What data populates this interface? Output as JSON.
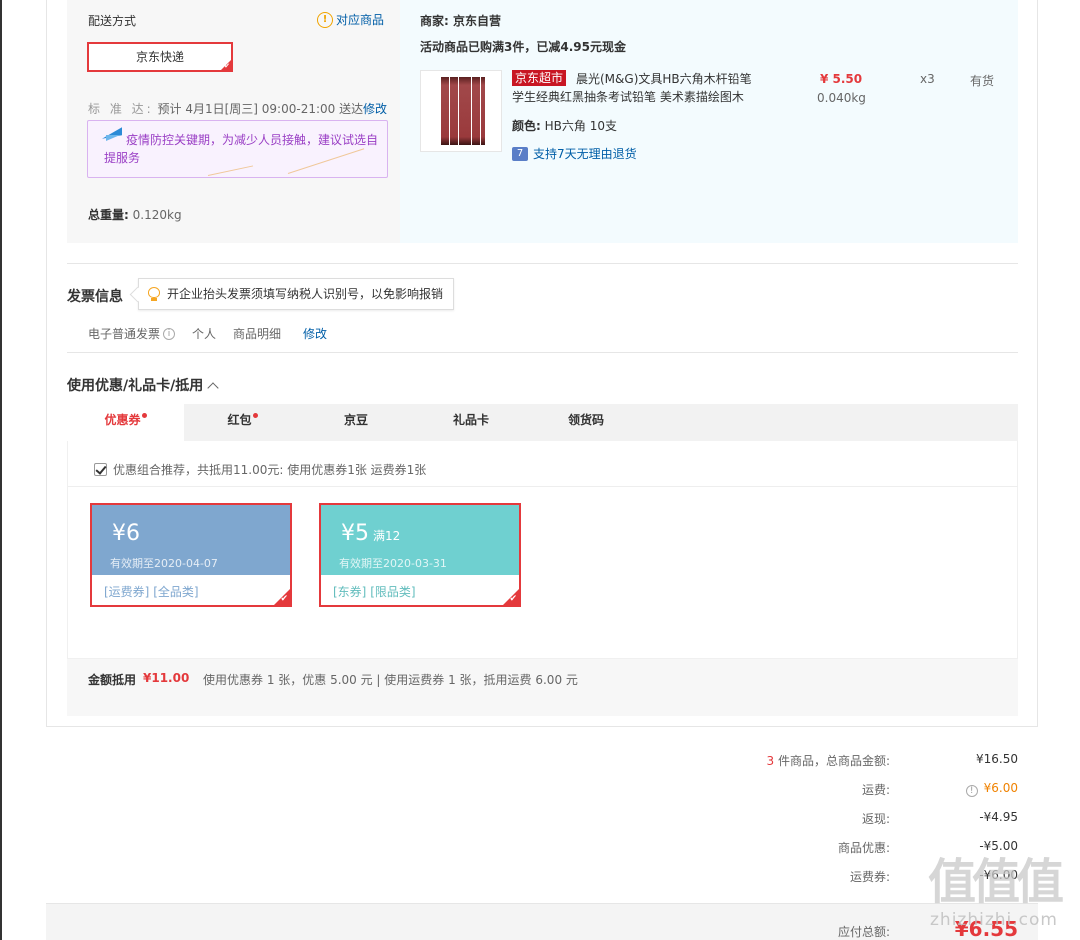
{
  "shipping": {
    "title": "配送方式",
    "match_link": "对应商品",
    "method": "京东快递",
    "date_label": "标 准 达:",
    "date_value": "预计 4月1日[周三] 09:00-21:00 送达",
    "edit": "修改",
    "notice": "疫情防控关键期，为减少人员接触，建议试选自提服务",
    "weight_label": "总重量:",
    "weight_value": "0.120kg"
  },
  "seller": {
    "label": "商家: 京东自营",
    "promo": "活动商品已购满3件，已减4.95元现金"
  },
  "product": {
    "tag": "京东超市",
    "name": "晨光(M&G)文具HB六角木杆铅笔学生经典红黑抽条考试铅笔 美术素描绘图木",
    "color_label": "颜色:",
    "color_value": "HB六角 10支",
    "return_icon": "7",
    "return_text": "支持7天无理由退货",
    "price": "¥ 5.50",
    "weight": "0.040kg",
    "qty": "x3",
    "stock": "有货"
  },
  "invoice": {
    "title": "发票信息",
    "tip": "开企业抬头发票须填写纳税人识别号，以免影响报销",
    "type": "电子普通发票",
    "holder": "个人",
    "content": "商品明细",
    "edit": "修改"
  },
  "coupons": {
    "title": "使用优惠/礼品卡/抵用",
    "tabs": [
      {
        "label": "优惠券"
      },
      {
        "label": "红包"
      },
      {
        "label": "京豆"
      },
      {
        "label": "礼品卡"
      },
      {
        "label": "领货码"
      }
    ],
    "recommend": "优惠组合推荐，共抵用11.00元: 使用优惠券1张 运费券1张",
    "items": [
      {
        "amount": "¥6",
        "condition": "",
        "expiry": "有效期至2020-04-07",
        "tag1": "[运费券]",
        "tag2": "[全品类]",
        "color": "#7fa7cf",
        "tag_color": "#7fa7cf"
      },
      {
        "amount": "¥5",
        "condition": "满12",
        "expiry": "有效期至2020-03-31",
        "tag1": "[东券]",
        "tag2": "[限品类]",
        "color": "#6fd0d0",
        "tag_color": "#62bdbd"
      }
    ],
    "summary_label": "金额抵用",
    "summary_value": "¥11.00",
    "summary_desc": "使用优惠券 1 张，优惠 5.00 元 | 使用运费券 1 张，抵用运费 6.00 元"
  },
  "totals": {
    "count": "3",
    "count_suffix": "件商品，总商品金额:",
    "goods_value": "¥16.50",
    "freight_label": "运费:",
    "freight_value": "¥6.00",
    "rebate_label": "返现:",
    "rebate_value": "-¥4.95",
    "discount_label": "商品优惠:",
    "discount_value": "-¥5.00",
    "freight_coupon_label": "运费券:",
    "freight_coupon_value": "-¥6.00",
    "pay_label": "应付总额:",
    "pay_value": "¥6.55"
  },
  "watermark": {
    "glyphs": "值值值",
    "text": "zhizhizhi.com"
  },
  "colors": {
    "accent_red": "#e4393c",
    "link_blue": "#005ea7",
    "orange": "#f08200"
  }
}
